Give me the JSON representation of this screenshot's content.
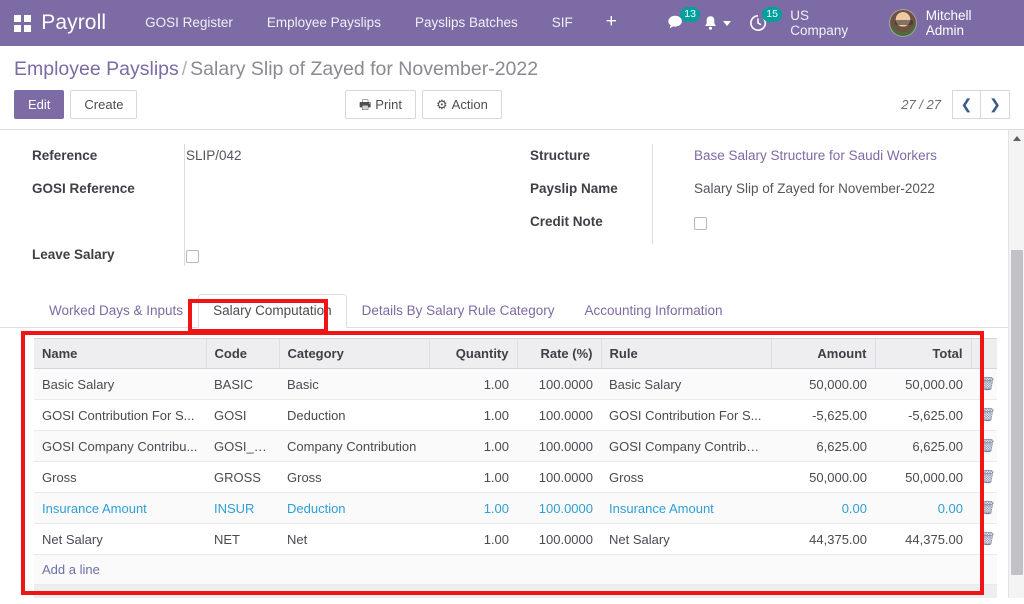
{
  "navbar": {
    "apps_icon": "apps-grid-icon",
    "brand": "Payroll",
    "menu_items": [
      {
        "label": "GOSI Register"
      },
      {
        "label": "Employee Payslips"
      },
      {
        "label": "Payslips Batches"
      },
      {
        "label": "SIF"
      }
    ],
    "plus_label": "+",
    "messages": {
      "icon": "chat-bubble-icon",
      "count": "13"
    },
    "activities_bell": {
      "icon": "bell-icon"
    },
    "clock": {
      "icon": "clock-icon",
      "count": "15"
    },
    "company": "US Company",
    "user": "Mitchell Admin",
    "badge_color": "#00A09D",
    "bar_color": "#7C6BA4"
  },
  "breadcrumb": {
    "parent": "Employee Payslips",
    "separator": "/",
    "current": "Salary Slip of Zayed for November-2022"
  },
  "control_panel": {
    "edit_label": "Edit",
    "create_label": "Create",
    "print_label": "Print",
    "print_icon": "printer-icon",
    "action_label": "Action",
    "action_icon": "gear-icon",
    "pager_text": "27 / 27",
    "prev_icon": "chevron-left-icon",
    "next_icon": "chevron-right-icon"
  },
  "form": {
    "left": [
      {
        "label": "Reference",
        "value": "SLIP/042",
        "type": "text"
      },
      {
        "label": "GOSI Reference",
        "value": "",
        "type": "text"
      },
      {
        "label": "Leave Salary",
        "value": "",
        "type": "checkbox",
        "checked": false
      }
    ],
    "right": [
      {
        "label": "Structure",
        "value": "Base Salary Structure for Saudi Workers",
        "type": "link"
      },
      {
        "label": "Payslip Name",
        "value": "Salary Slip of Zayed for November-2022",
        "type": "text"
      },
      {
        "label": "Credit Note",
        "value": "",
        "type": "checkbox",
        "checked": false
      }
    ]
  },
  "notebook": {
    "tabs": [
      {
        "label": "Worked Days & Inputs",
        "active": false
      },
      {
        "label": "Salary Computation",
        "active": true
      },
      {
        "label": "Details By Salary Rule Category",
        "active": false
      },
      {
        "label": "Accounting Information",
        "active": false
      }
    ]
  },
  "table": {
    "columns": [
      {
        "label": "Name",
        "align": "left"
      },
      {
        "label": "Code",
        "align": "left"
      },
      {
        "label": "Category",
        "align": "left"
      },
      {
        "label": "Quantity",
        "align": "right"
      },
      {
        "label": "Rate (%)",
        "align": "right"
      },
      {
        "label": "Rule",
        "align": "left"
      },
      {
        "label": "Amount",
        "align": "right"
      },
      {
        "label": "Total",
        "align": "right"
      }
    ],
    "rows": [
      {
        "name": "Basic Salary",
        "code": "BASIC",
        "category": "Basic",
        "quantity": "1.00",
        "rate": "100.0000",
        "rule": "Basic Salary",
        "amount": "50,000.00",
        "total": "50,000.00",
        "selected": false
      },
      {
        "name": "GOSI Contribution For S...",
        "code": "GOSI",
        "category": "Deduction",
        "quantity": "1.00",
        "rate": "100.0000",
        "rule": "GOSI Contribution For S...",
        "amount": "-5,625.00",
        "total": "-5,625.00",
        "selected": false
      },
      {
        "name": "GOSI Company Contribu...",
        "code": "GOSI_COMP",
        "category": "Company Contribution",
        "quantity": "1.00",
        "rate": "100.0000",
        "rule": "GOSI Company Contribu...",
        "amount": "6,625.00",
        "total": "6,625.00",
        "selected": false
      },
      {
        "name": "Gross",
        "code": "GROSS",
        "category": "Gross",
        "quantity": "1.00",
        "rate": "100.0000",
        "rule": "Gross",
        "amount": "50,000.00",
        "total": "50,000.00",
        "selected": false
      },
      {
        "name": "Insurance Amount",
        "code": "INSUR",
        "category": "Deduction",
        "quantity": "1.00",
        "rate": "100.0000",
        "rule": "Insurance Amount",
        "amount": "0.00",
        "total": "0.00",
        "selected": true
      },
      {
        "name": "Net Salary",
        "code": "NET",
        "category": "Net",
        "quantity": "1.00",
        "rate": "100.0000",
        "rule": "Net Salary",
        "amount": "44,375.00",
        "total": "44,375.00",
        "selected": false
      }
    ],
    "delete_icon": "trash-icon",
    "add_line_label": "Add a line"
  },
  "annotations": {
    "highlight_color": "#f01515",
    "boxes": [
      {
        "name": "salary-computation-tab-highlight"
      },
      {
        "name": "salary-computation-table-highlight"
      }
    ]
  }
}
